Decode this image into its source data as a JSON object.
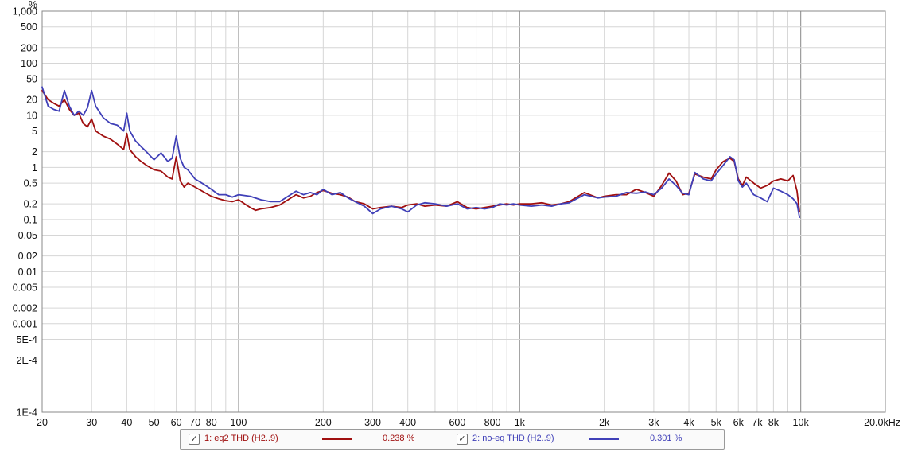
{
  "chart_data": {
    "type": "line",
    "title": "",
    "xlabel": "",
    "ylabel": "%",
    "x_scale": "log",
    "y_scale": "log",
    "xlim": [
      20,
      20000
    ],
    "ylim": [
      1e-06,
      1000
    ],
    "grid": true,
    "legend_position": "bottom",
    "x_ticks": [
      {
        "v": 20,
        "label": "20"
      },
      {
        "v": 30,
        "label": "30"
      },
      {
        "v": 40,
        "label": "40"
      },
      {
        "v": 50,
        "label": "50"
      },
      {
        "v": 60,
        "label": "60"
      },
      {
        "v": 70,
        "label": "70"
      },
      {
        "v": 80,
        "label": "80"
      },
      {
        "v": 100,
        "label": "100"
      },
      {
        "v": 200,
        "label": "200"
      },
      {
        "v": 300,
        "label": "300"
      },
      {
        "v": 400,
        "label": "400"
      },
      {
        "v": 600,
        "label": "600"
      },
      {
        "v": 800,
        "label": "800"
      },
      {
        "v": 1000,
        "label": "1k"
      },
      {
        "v": 2000,
        "label": "2k"
      },
      {
        "v": 3000,
        "label": "3k"
      },
      {
        "v": 4000,
        "label": "4k"
      },
      {
        "v": 5000,
        "label": "5k"
      },
      {
        "v": 6000,
        "label": "6k"
      },
      {
        "v": 7000,
        "label": "7k"
      },
      {
        "v": 8000,
        "label": "8k"
      },
      {
        "v": 10000,
        "label": "10k"
      },
      {
        "v": 20000,
        "label": "20.0kHz"
      }
    ],
    "y_ticks": [
      {
        "v": 1000,
        "label": "1,000"
      },
      {
        "v": 500,
        "label": "500"
      },
      {
        "v": 200,
        "label": "200"
      },
      {
        "v": 100,
        "label": "100"
      },
      {
        "v": 50,
        "label": "50"
      },
      {
        "v": 20,
        "label": "20"
      },
      {
        "v": 10,
        "label": "10"
      },
      {
        "v": 5,
        "label": "5"
      },
      {
        "v": 2,
        "label": "2"
      },
      {
        "v": 1,
        "label": "1"
      },
      {
        "v": 0.5,
        "label": "0.5"
      },
      {
        "v": 0.2,
        "label": "0.2"
      },
      {
        "v": 0.1,
        "label": "0.1"
      },
      {
        "v": 0.05,
        "label": "0.05"
      },
      {
        "v": 0.02,
        "label": "0.02"
      },
      {
        "v": 0.01,
        "label": "0.01"
      },
      {
        "v": 0.005,
        "label": "0.005"
      },
      {
        "v": 0.002,
        "label": "0.002"
      },
      {
        "v": 0.001,
        "label": "0.001"
      },
      {
        "v": 0.0005,
        "label": "5E-4"
      },
      {
        "v": 0.0002,
        "label": "2E-4"
      },
      {
        "v": 1e-06,
        "label": "1E-4"
      }
    ],
    "series": [
      {
        "name": "1: eq2 THD (H2..9)",
        "value_label": "0.238 %",
        "color": "#a01010",
        "points": [
          [
            20,
            30
          ],
          [
            21,
            20
          ],
          [
            22,
            17
          ],
          [
            23,
            15
          ],
          [
            24,
            20
          ],
          [
            25,
            13
          ],
          [
            26,
            10
          ],
          [
            27,
            11
          ],
          [
            28,
            7
          ],
          [
            29,
            6
          ],
          [
            30,
            8.5
          ],
          [
            31,
            5
          ],
          [
            33,
            4
          ],
          [
            35,
            3.5
          ],
          [
            37,
            2.8
          ],
          [
            39,
            2.2
          ],
          [
            40,
            4.5
          ],
          [
            41,
            2.2
          ],
          [
            43,
            1.6
          ],
          [
            45,
            1.3
          ],
          [
            47,
            1.1
          ],
          [
            50,
            0.9
          ],
          [
            53,
            0.85
          ],
          [
            56,
            0.65
          ],
          [
            58,
            0.6
          ],
          [
            60,
            1.6
          ],
          [
            62,
            0.55
          ],
          [
            64,
            0.42
          ],
          [
            66,
            0.5
          ],
          [
            70,
            0.42
          ],
          [
            75,
            0.34
          ],
          [
            80,
            0.28
          ],
          [
            85,
            0.25
          ],
          [
            90,
            0.23
          ],
          [
            95,
            0.22
          ],
          [
            100,
            0.24
          ],
          [
            105,
            0.2
          ],
          [
            110,
            0.17
          ],
          [
            115,
            0.15
          ],
          [
            120,
            0.16
          ],
          [
            130,
            0.17
          ],
          [
            140,
            0.19
          ],
          [
            150,
            0.24
          ],
          [
            160,
            0.3
          ],
          [
            170,
            0.26
          ],
          [
            180,
            0.28
          ],
          [
            190,
            0.33
          ],
          [
            200,
            0.36
          ],
          [
            215,
            0.32
          ],
          [
            230,
            0.3
          ],
          [
            245,
            0.27
          ],
          [
            260,
            0.22
          ],
          [
            280,
            0.2
          ],
          [
            300,
            0.16
          ],
          [
            320,
            0.17
          ],
          [
            350,
            0.18
          ],
          [
            380,
            0.17
          ],
          [
            400,
            0.19
          ],
          [
            430,
            0.2
          ],
          [
            460,
            0.18
          ],
          [
            500,
            0.19
          ],
          [
            550,
            0.18
          ],
          [
            600,
            0.22
          ],
          [
            650,
            0.17
          ],
          [
            700,
            0.16
          ],
          [
            750,
            0.17
          ],
          [
            800,
            0.18
          ],
          [
            850,
            0.19
          ],
          [
            900,
            0.2
          ],
          [
            950,
            0.19
          ],
          [
            1000,
            0.2
          ],
          [
            1100,
            0.2
          ],
          [
            1200,
            0.21
          ],
          [
            1300,
            0.19
          ],
          [
            1400,
            0.2
          ],
          [
            1500,
            0.22
          ],
          [
            1700,
            0.33
          ],
          [
            1900,
            0.26
          ],
          [
            2000,
            0.28
          ],
          [
            2200,
            0.3
          ],
          [
            2400,
            0.3
          ],
          [
            2600,
            0.38
          ],
          [
            2800,
            0.33
          ],
          [
            3000,
            0.28
          ],
          [
            3200,
            0.45
          ],
          [
            3400,
            0.78
          ],
          [
            3600,
            0.55
          ],
          [
            3800,
            0.3
          ],
          [
            4000,
            0.32
          ],
          [
            4200,
            0.75
          ],
          [
            4500,
            0.65
          ],
          [
            4800,
            0.6
          ],
          [
            5000,
            0.9
          ],
          [
            5300,
            1.3
          ],
          [
            5600,
            1.5
          ],
          [
            5800,
            1.3
          ],
          [
            6000,
            0.6
          ],
          [
            6200,
            0.45
          ],
          [
            6400,
            0.65
          ],
          [
            6800,
            0.5
          ],
          [
            7200,
            0.4
          ],
          [
            7600,
            0.45
          ],
          [
            8000,
            0.55
          ],
          [
            8500,
            0.6
          ],
          [
            9000,
            0.55
          ],
          [
            9400,
            0.7
          ],
          [
            9700,
            0.35
          ],
          [
            9900,
            0.14
          ]
        ]
      },
      {
        "name": "2: no-eq THD (H2..9)",
        "value_label": "0.301 %",
        "color": "#4040b8",
        "points": [
          [
            20,
            35
          ],
          [
            21,
            15
          ],
          [
            22,
            13
          ],
          [
            23,
            12
          ],
          [
            24,
            30
          ],
          [
            25,
            15
          ],
          [
            26,
            10
          ],
          [
            27,
            12
          ],
          [
            28,
            10
          ],
          [
            29,
            14
          ],
          [
            30,
            30
          ],
          [
            31,
            15
          ],
          [
            33,
            9
          ],
          [
            35,
            7
          ],
          [
            37,
            6.5
          ],
          [
            39,
            5
          ],
          [
            40,
            11
          ],
          [
            41,
            5
          ],
          [
            43,
            3.2
          ],
          [
            45,
            2.5
          ],
          [
            47,
            2
          ],
          [
            50,
            1.4
          ],
          [
            53,
            1.9
          ],
          [
            56,
            1.3
          ],
          [
            58,
            1.5
          ],
          [
            60,
            4
          ],
          [
            62,
            1.5
          ],
          [
            64,
            1
          ],
          [
            66,
            0.9
          ],
          [
            70,
            0.6
          ],
          [
            75,
            0.48
          ],
          [
            80,
            0.38
          ],
          [
            85,
            0.3
          ],
          [
            90,
            0.3
          ],
          [
            95,
            0.27
          ],
          [
            100,
            0.3
          ],
          [
            110,
            0.28
          ],
          [
            120,
            0.24
          ],
          [
            130,
            0.22
          ],
          [
            140,
            0.22
          ],
          [
            150,
            0.28
          ],
          [
            160,
            0.35
          ],
          [
            170,
            0.3
          ],
          [
            180,
            0.33
          ],
          [
            190,
            0.3
          ],
          [
            200,
            0.38
          ],
          [
            215,
            0.3
          ],
          [
            230,
            0.33
          ],
          [
            245,
            0.26
          ],
          [
            260,
            0.22
          ],
          [
            280,
            0.18
          ],
          [
            300,
            0.13
          ],
          [
            320,
            0.16
          ],
          [
            350,
            0.18
          ],
          [
            380,
            0.16
          ],
          [
            400,
            0.14
          ],
          [
            430,
            0.19
          ],
          [
            460,
            0.21
          ],
          [
            500,
            0.2
          ],
          [
            550,
            0.18
          ],
          [
            600,
            0.2
          ],
          [
            650,
            0.16
          ],
          [
            700,
            0.17
          ],
          [
            750,
            0.16
          ],
          [
            800,
            0.17
          ],
          [
            850,
            0.2
          ],
          [
            900,
            0.19
          ],
          [
            950,
            0.2
          ],
          [
            1000,
            0.19
          ],
          [
            1100,
            0.18
          ],
          [
            1200,
            0.19
          ],
          [
            1300,
            0.18
          ],
          [
            1400,
            0.2
          ],
          [
            1500,
            0.21
          ],
          [
            1700,
            0.3
          ],
          [
            1900,
            0.26
          ],
          [
            2000,
            0.27
          ],
          [
            2200,
            0.28
          ],
          [
            2400,
            0.33
          ],
          [
            2600,
            0.32
          ],
          [
            2800,
            0.34
          ],
          [
            3000,
            0.3
          ],
          [
            3200,
            0.4
          ],
          [
            3400,
            0.6
          ],
          [
            3600,
            0.45
          ],
          [
            3800,
            0.32
          ],
          [
            4000,
            0.3
          ],
          [
            4200,
            0.8
          ],
          [
            4500,
            0.6
          ],
          [
            4800,
            0.55
          ],
          [
            5000,
            0.75
          ],
          [
            5300,
            1.1
          ],
          [
            5600,
            1.6
          ],
          [
            5800,
            1.4
          ],
          [
            6000,
            0.55
          ],
          [
            6200,
            0.42
          ],
          [
            6400,
            0.5
          ],
          [
            6800,
            0.3
          ],
          [
            7200,
            0.26
          ],
          [
            7600,
            0.22
          ],
          [
            8000,
            0.4
          ],
          [
            8500,
            0.35
          ],
          [
            9000,
            0.3
          ],
          [
            9400,
            0.25
          ],
          [
            9700,
            0.2
          ],
          [
            9900,
            0.11
          ]
        ]
      }
    ]
  }
}
